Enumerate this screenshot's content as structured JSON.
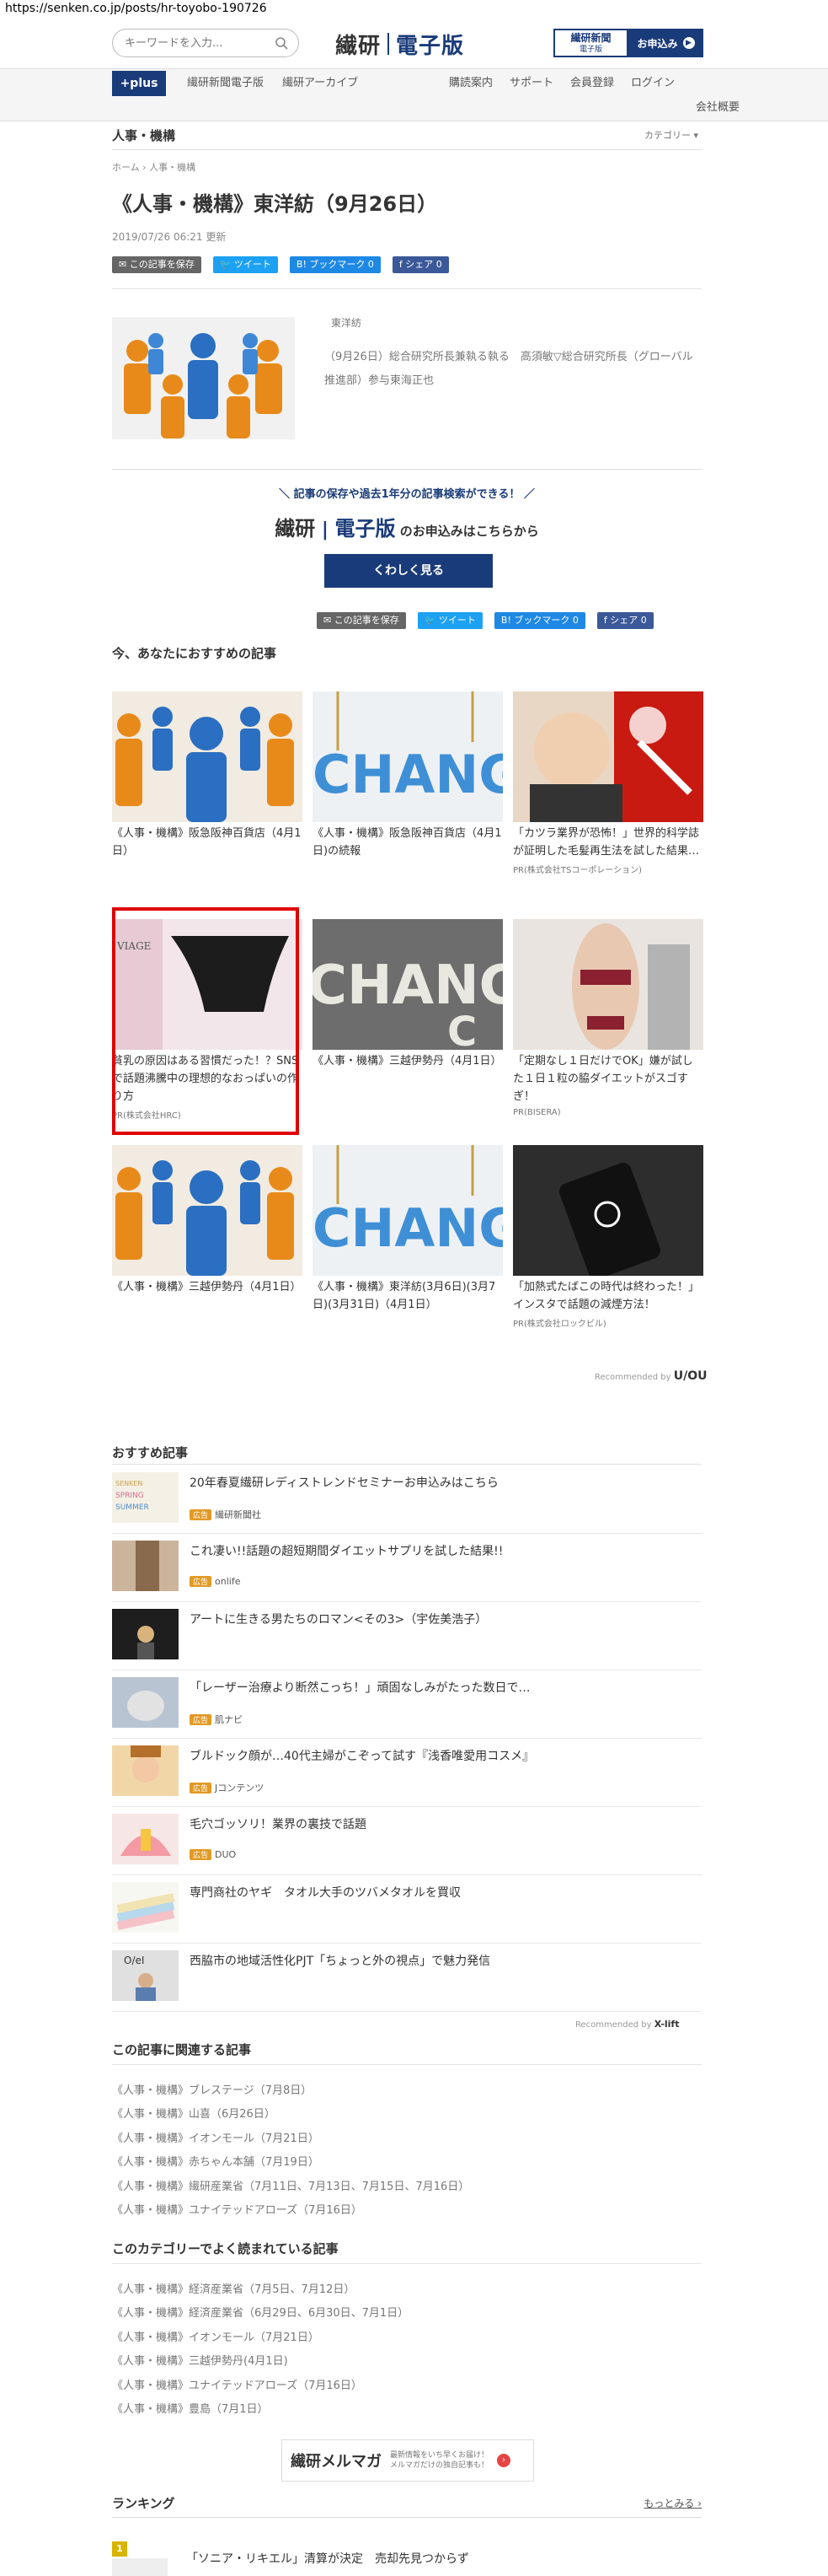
{
  "url": "https://senken.co.jp/posts/hr-toyobo-190726",
  "header": {
    "search_placeholder": "キーワードを入力...",
    "logo_left": "繊研",
    "logo_right": "電子版",
    "btn_newspaper_main": "繊研新聞",
    "btn_newspaper_sub": "電子版",
    "btn_apply": "お申込み",
    "brand_color": "#1a3b79"
  },
  "nav": {
    "plus": "+plus",
    "left": [
      "繊研新聞電子版",
      "繊研アーカイブ"
    ],
    "right": [
      "購読案内",
      "サポート",
      "会員登録",
      "ログイン"
    ],
    "company": "会社概要"
  },
  "category_bar": {
    "title": "人事・機構",
    "right": "カテゴリー ▾"
  },
  "article": {
    "breadcrumb": [
      "ホーム",
      "人事・機構"
    ],
    "title": "《人事・機構》東洋紡（9月26日）",
    "date": "2019/07/26 06:21 更新",
    "company": "東洋紡",
    "body": "（9月26日）総合研究所長兼執る執る　高須敏▽総合研究所長（グローバル推進部）参与東海正也"
  },
  "share": {
    "save": "この記事を保存",
    "tweet": "ツイート",
    "hatena": "B! ブックマーク",
    "hatena_count": "0",
    "facebook": "シェア",
    "facebook_count": "0"
  },
  "promo": {
    "line1": "記事の保存や過去1年分の記事検索ができる！",
    "logo_left": "繊研",
    "logo_right": "電子版",
    "line2": "のお申込みはこちらから",
    "button": "くわしく見る"
  },
  "recommended": {
    "heading": "今、あなたにおすすめの記事",
    "cards": [
      {
        "caption": "《人事・機構》阪急阪神百貨店（4月1日）",
        "pr": ""
      },
      {
        "caption": "《人事・機構》阪急阪神百貨店（4月1日)の続報",
        "pr": ""
      },
      {
        "caption": "「カツラ業界が恐怖！」世界的科学誌が証明した毛髪再生法を試した結果…",
        "pr": "PR(株式会社TSコーポレーション)"
      },
      {
        "caption": "貧乳の原因はある習慣だった！？SNSで話題沸騰中の理想的なおっぱいの作り方",
        "pr": "PR(株式会社HRC)"
      },
      {
        "caption": "《人事・機構》三越伊勢丹（4月1日）",
        "pr": ""
      },
      {
        "caption": "「定期なし１日だけでOK」嫌が試した１日１粒の脇ダイエットがスゴすぎ！",
        "pr": "PR(BISERA)"
      },
      {
        "caption": "《人事・機構》三越伊勢丹（4月1日）",
        "pr": ""
      },
      {
        "caption": "《人事・機構》東洋紡(3月6日)(3月7日)(3月31日)（4月1日）",
        "pr": ""
      },
      {
        "caption": "「加熱式たばこの時代は終わった！」インスタで話題の減煙方法！",
        "pr": "PR(株式会社ロックビル)"
      }
    ],
    "recommended_by": "Recommended by",
    "recommended_brand": "U/OU"
  },
  "osusume": {
    "heading": "おすすめ記事",
    "items": [
      {
        "title": "20年春夏繊研レディストレンドセミナーお申込みはこちら",
        "badge": "広告",
        "source": "繊研新聞社"
      },
      {
        "title": "これ凄い!!話題の超短期間ダイエットサプリを試した結果!!",
        "badge": "広告",
        "source": "onlife"
      },
      {
        "title": "アートに生きる男たちのロマン<その3>（宇佐美浩子）",
        "badge": "",
        "source": ""
      },
      {
        "title": "「レーザー治療より断然こっち！」頑固なしみがたった数日で…",
        "badge": "広告",
        "source": "肌ナビ"
      },
      {
        "title": "ブルドック顔が…40代主婦がこぞって試す『浅香唯愛用コスメ』",
        "badge": "広告",
        "source": "Jコンテンツ"
      },
      {
        "title": "毛穴ゴッソリ！業界の裏技で話題",
        "badge": "広告",
        "source": "DUO"
      },
      {
        "title": "専門商社のヤギ　タオル大手のツバメタオルを買収",
        "badge": "",
        "source": ""
      },
      {
        "title": "西脇市の地域活性化PJT「ちょっと外の視点」で魅力発信",
        "badge": "",
        "source": ""
      }
    ],
    "recommended_by": "Recommended by",
    "recommended_brand": "X-lift"
  },
  "related": {
    "heading": "この記事に関連する記事",
    "items": [
      "《人事・機構》ブレステージ（7月8日）",
      "《人事・機構》山喜（6月26日）",
      "《人事・機構》イオンモール（7月21日）",
      "《人事・機構》赤ちゃん本舗（7月19日）",
      "《人事・機構》繊研産業省（7月11日、7月13日、7月15日、7月16日）",
      "《人事・機構》ユナイテッドアローズ（7月16日）"
    ]
  },
  "popular": {
    "heading": "このカテゴリーでよく読まれている記事",
    "items": [
      "《人事・機構》経済産業省（7月5日、7月12日）",
      "《人事・機構》経済産業省（6月29日、6月30日、7月1日）",
      "《人事・機構》イオンモール（7月21日）",
      "《人事・機構》三越伊勢丹(4月1日)",
      "《人事・機構》ユナイテッドアローズ（7月16日）",
      "《人事・機構》豊島（7月1日）"
    ]
  },
  "mailmag": {
    "name": "繊研メルマガ",
    "sub1": "最新情報をいち早くお届け！",
    "sub2": "メルマガだけの独自記事も！"
  },
  "ranking": {
    "heading": "ランキング",
    "more": "もっとみる ›",
    "first_num": "1",
    "first_title": "「ソニア・リキエル」清算が決定　売却先見つからず"
  }
}
